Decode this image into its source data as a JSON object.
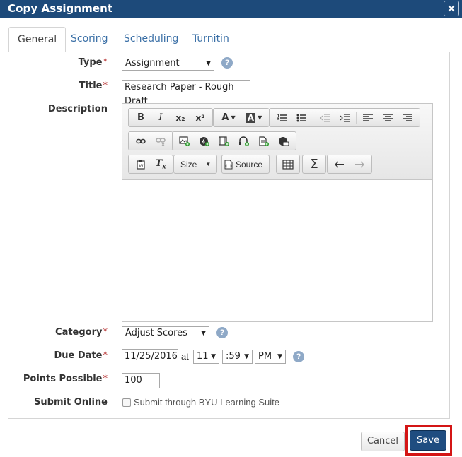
{
  "dialog": {
    "title": "Copy Assignment"
  },
  "tabs": [
    {
      "label": "General"
    },
    {
      "label": "Scoring"
    },
    {
      "label": "Scheduling"
    },
    {
      "label": "Turnitin"
    }
  ],
  "form": {
    "type": {
      "label": "Type",
      "value": "Assignment"
    },
    "title": {
      "label": "Title",
      "value": "Research Paper - Rough Draft"
    },
    "description": {
      "label": "Description"
    },
    "category": {
      "label": "Category",
      "value": "Adjust Scores"
    },
    "due_date": {
      "label": "Due Date",
      "date": "11/25/2016",
      "at": "at",
      "hour": "11",
      "minute": ":59",
      "ampm": "PM"
    },
    "points": {
      "label": "Points Possible",
      "value": "100"
    },
    "submit_online": {
      "label": "Submit Online",
      "checkbox_label": "Submit through BYU Learning Suite",
      "checked": false
    },
    "required_mark": "*",
    "help_glyph": "?"
  },
  "editor": {
    "toolbar": {
      "bold": "B",
      "italic": "I",
      "subscript": "x₂",
      "superscript": "x²",
      "text_color": "A",
      "bg_color": "A",
      "size_label": "Size",
      "source_label": "Source",
      "sigma": "Σ"
    }
  },
  "buttons": {
    "cancel": "Cancel",
    "save": "Save"
  },
  "colors": {
    "titlebar": "#1d4a7a",
    "accent": "#1f4d80",
    "highlight": "#d41515",
    "link": "#3a6fa6"
  }
}
